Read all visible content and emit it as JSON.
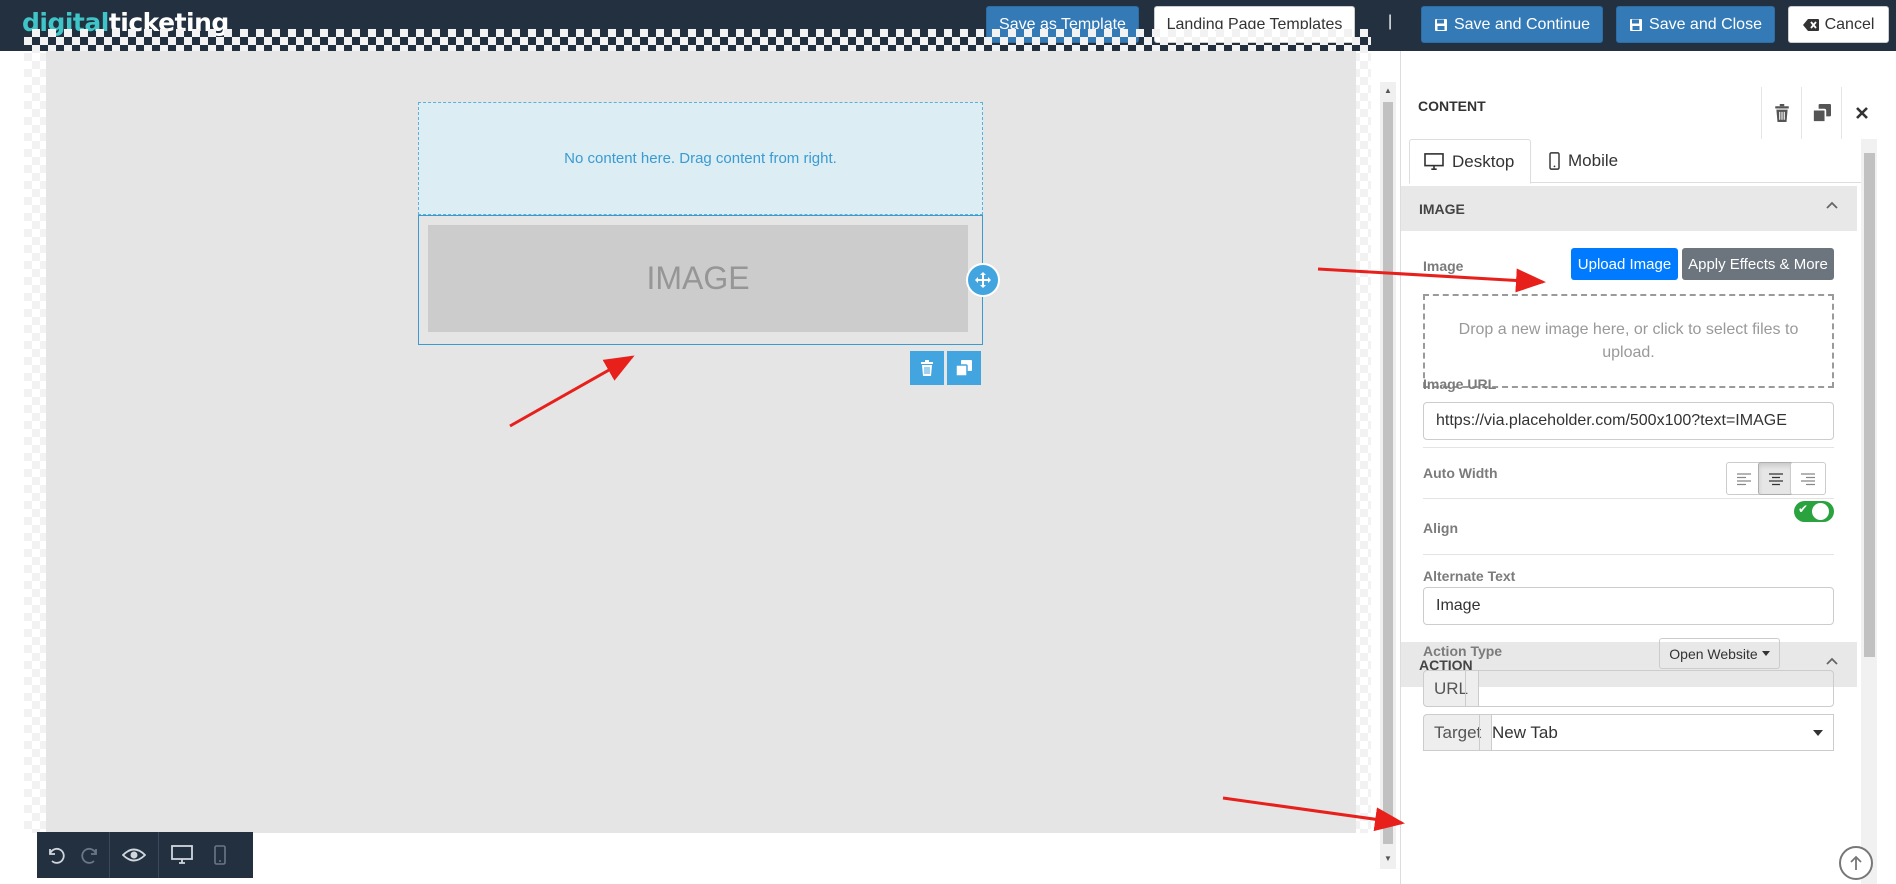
{
  "brand": {
    "logo_part1": "digital",
    "logo_part2": "ticketing"
  },
  "topbar": {
    "save_as_template": "Save as Template",
    "landing_page_templates": "Landing Page Templates",
    "separator": "|",
    "save_and_continue": "Save and Continue",
    "save_and_close": "Save and Close",
    "cancel": "Cancel"
  },
  "canvas": {
    "empty_row_text": "No content here. Drag content from right.",
    "image_placeholder_text": "IMAGE"
  },
  "sidebar": {
    "title": "CONTENT",
    "tabs": [
      {
        "label": "Desktop",
        "active": true
      },
      {
        "label": "Mobile",
        "active": false
      }
    ],
    "image_section": {
      "header": "IMAGE",
      "image_label": "Image",
      "upload_button": "Upload Image",
      "effects_button": "Apply Effects & More",
      "dropzone_text": "Drop a new image here, or click to select files to upload.",
      "image_url_label": "Image URL",
      "image_url_value": "https://via.placeholder.com/500x100?text=IMAGE",
      "auto_width_label": "Auto Width",
      "auto_width_on": true,
      "align_label": "Align",
      "align_selected": "center",
      "alt_text_label": "Alternate Text",
      "alt_text_value": "Image"
    },
    "action_section": {
      "header": "ACTION",
      "action_type_label": "Action Type",
      "action_type_value": "Open Website",
      "url_addon": "URL",
      "url_value": "",
      "target_addon": "Target",
      "target_value": "New Tab"
    }
  },
  "colors": {
    "topbar_bg": "#23303f",
    "primary_blue": "#337ab7",
    "upload_blue": "#007bff",
    "effects_gray": "#6c757d",
    "accent_light_blue": "#42a5e0",
    "toggle_green": "#2aa33f",
    "annotation_red": "#e8201c"
  }
}
